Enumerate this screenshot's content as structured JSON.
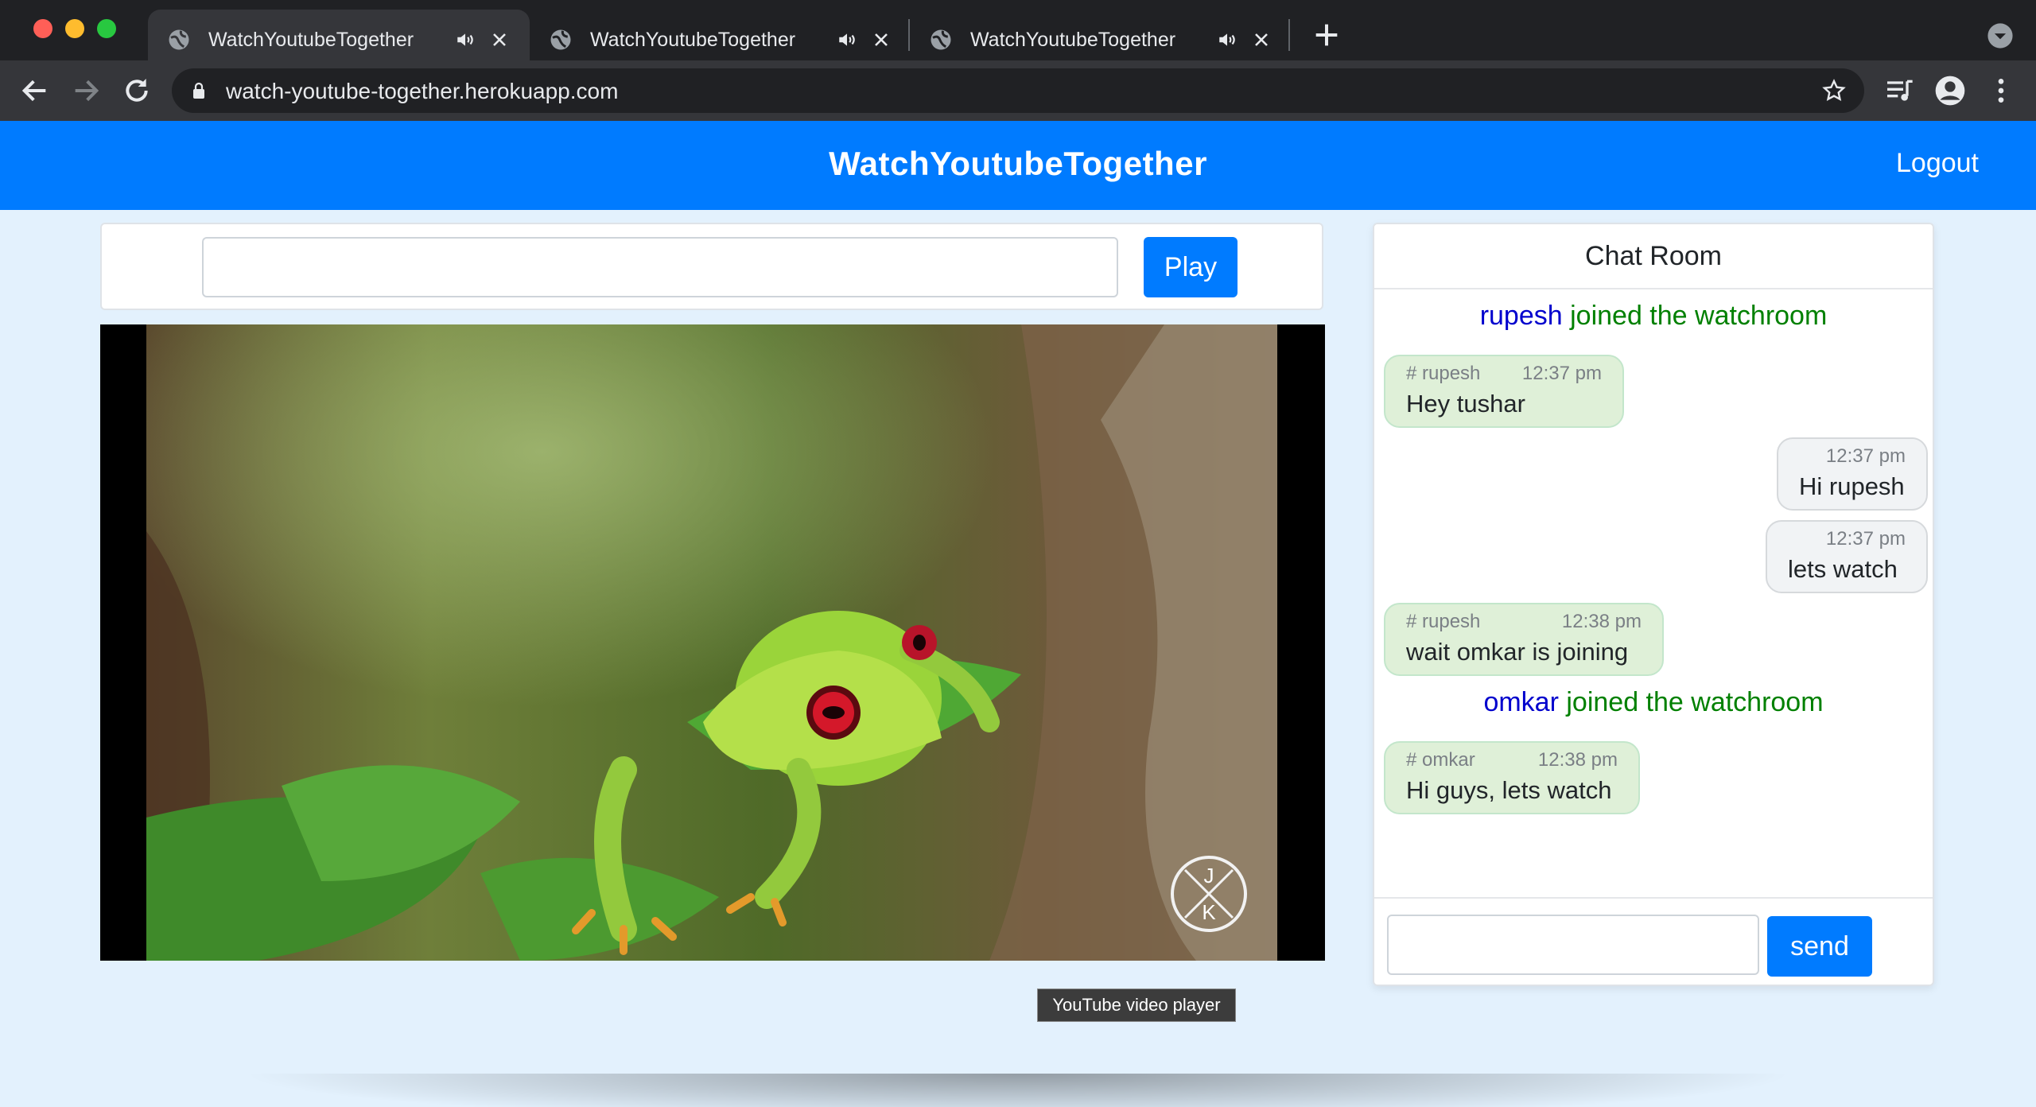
{
  "browser": {
    "tabs": [
      {
        "title": "WatchYoutubeTogether",
        "active": true
      },
      {
        "title": "WatchYoutubeTogether",
        "active": false
      },
      {
        "title": "WatchYoutubeTogether",
        "active": false
      }
    ],
    "url": "watch-youtube-together.herokuapp.com"
  },
  "navbar": {
    "brand": "WatchYoutubeTogether",
    "logout_label": "Logout",
    "color": "#007bff"
  },
  "player_controls": {
    "url_input_value": "",
    "play_label": "Play"
  },
  "player": {
    "tooltip": "YouTube video player",
    "watermark": "JK"
  },
  "chat": {
    "title": "Chat Room",
    "events": [
      {
        "user": "rupesh",
        "text": "joined the watchroom"
      },
      {
        "user": "omkar",
        "text": "joined the watchroom"
      }
    ],
    "messages": [
      {
        "sender": "# rupesh",
        "time": "12:37 pm",
        "text": "Hey tushar",
        "mine": false
      },
      {
        "sender": "",
        "time": "12:37 pm",
        "text": "Hi rupesh",
        "mine": true
      },
      {
        "sender": "",
        "time": "12:37 pm",
        "text": "lets watch",
        "mine": true
      },
      {
        "sender": "# rupesh",
        "time": "12:38 pm",
        "text": "wait omkar is joining",
        "mine": false
      },
      {
        "sender": "# omkar",
        "time": "12:38 pm",
        "text": "Hi guys, lets watch",
        "mine": false
      }
    ],
    "input_value": "",
    "send_label": "send"
  }
}
